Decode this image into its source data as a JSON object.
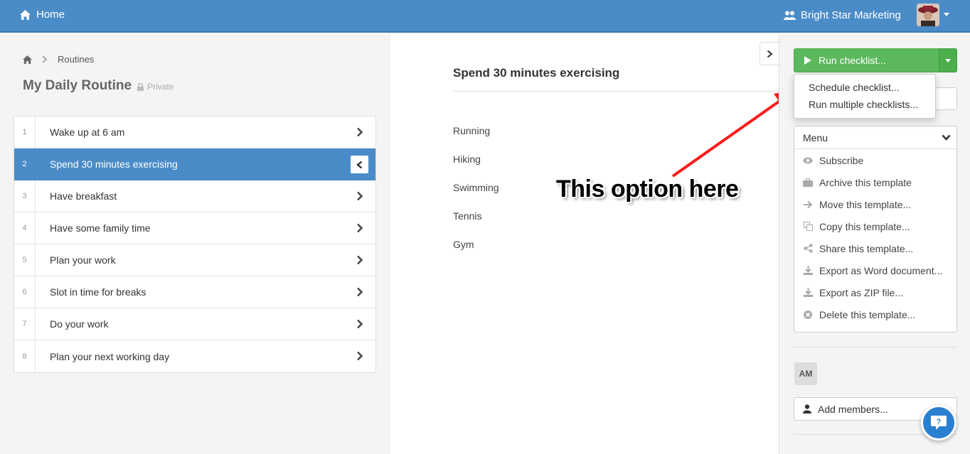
{
  "topbar": {
    "home_label": "Home",
    "org_name": "Bright Star Marketing"
  },
  "breadcrumb": {
    "current": "Routines"
  },
  "checklist": {
    "title": "My Daily Routine",
    "visibility": "Private"
  },
  "tasks": [
    {
      "num": "1",
      "label": "Wake up at 6 am"
    },
    {
      "num": "2",
      "label": "Spend 30 minutes exercising"
    },
    {
      "num": "3",
      "label": "Have breakfast"
    },
    {
      "num": "4",
      "label": "Have some family time"
    },
    {
      "num": "5",
      "label": "Plan your work"
    },
    {
      "num": "6",
      "label": "Slot in time for breaks"
    },
    {
      "num": "7",
      "label": "Do your work"
    },
    {
      "num": "8",
      "label": "Plan your next working day"
    }
  ],
  "active_task_index": 1,
  "detail": {
    "title": "Spend 30 minutes exercising",
    "options": [
      "Running",
      "Hiking",
      "Swimming",
      "Tennis",
      "Gym"
    ]
  },
  "annotation": {
    "text": "This option here",
    "arrow_color": "#ff1a1a"
  },
  "sidebar": {
    "run_label": "Run checklist...",
    "dropdown": [
      "Schedule checklist...",
      "Run multiple checklists..."
    ],
    "menu_label": "Menu",
    "menu_items": [
      {
        "icon": "eye-icon",
        "label": "Subscribe"
      },
      {
        "icon": "briefcase-icon",
        "label": "Archive this template"
      },
      {
        "icon": "arrow-right-icon",
        "label": "Move this template..."
      },
      {
        "icon": "copy-icon",
        "label": "Copy this template..."
      },
      {
        "icon": "share-icon",
        "label": "Share this template..."
      },
      {
        "icon": "download-icon",
        "label": "Export as Word document..."
      },
      {
        "icon": "download-icon",
        "label": "Export as ZIP file..."
      },
      {
        "icon": "delete-circle-icon",
        "label": "Delete this template..."
      }
    ],
    "member_initials": "AM",
    "add_members_label": "Add members..."
  },
  "colors": {
    "topbar": "#4a8cc8",
    "active_row": "#4a8cc8",
    "run_button": "#5cb85c",
    "help_bubble": "#2a7fd0"
  }
}
